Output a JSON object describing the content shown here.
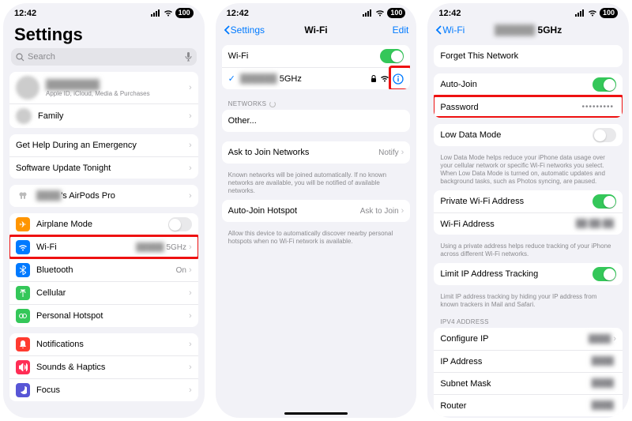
{
  "status": {
    "time": "12:42",
    "battery": "100"
  },
  "screen1": {
    "title": "Settings",
    "search_placeholder": "Search",
    "profile_sub": "Apple ID, iCloud, Media & Purchases",
    "family": "Family",
    "help": "Get Help During an Emergency",
    "update": "Software Update Tonight",
    "airpods": "'s AirPods Pro",
    "airplane": "Airplane Mode",
    "wifi": "Wi-Fi",
    "wifi_val": "5GHz",
    "bluetooth": "Bluetooth",
    "bluetooth_val": "On",
    "cellular": "Cellular",
    "hotspot": "Personal Hotspot",
    "notifications": "Notifications",
    "sounds": "Sounds & Haptics",
    "focus": "Focus"
  },
  "screen2": {
    "back": "Settings",
    "title": "Wi-Fi",
    "edit": "Edit",
    "wifi_label": "Wi-Fi",
    "current": "5GHz",
    "networks": "Networks",
    "other": "Other...",
    "ask": "Ask to Join Networks",
    "ask_val": "Notify",
    "ask_note": "Known networks will be joined automatically. If no known networks are available, you will be notified of available networks.",
    "autohot": "Auto-Join Hotspot",
    "autohot_val": "Ask to Join",
    "autohot_note": "Allow this device to automatically discover nearby personal hotspots when no Wi-Fi network is available."
  },
  "screen3": {
    "back": "Wi-Fi",
    "title": "5GHz",
    "forget": "Forget This Network",
    "autojoin": "Auto-Join",
    "password": "Password",
    "password_val": "•••••••••",
    "lowdata": "Low Data Mode",
    "lowdata_note": "Low Data Mode helps reduce your iPhone data usage over your cellular network or specific Wi-Fi networks you select. When Low Data Mode is turned on, automatic updates and background tasks, such as Photos syncing, are paused.",
    "private": "Private Wi-Fi Address",
    "wifiaddr": "Wi-Fi Address",
    "private_note": "Using a private address helps reduce tracking of your iPhone across different Wi-Fi networks.",
    "limit": "Limit IP Address Tracking",
    "limit_note": "Limit IP address tracking by hiding your IP address from known trackers in Mail and Safari.",
    "ipv4": "IPV4 Address",
    "configip": "Configure IP",
    "ipaddr": "IP Address",
    "subnet": "Subnet Mask",
    "router": "Router"
  }
}
